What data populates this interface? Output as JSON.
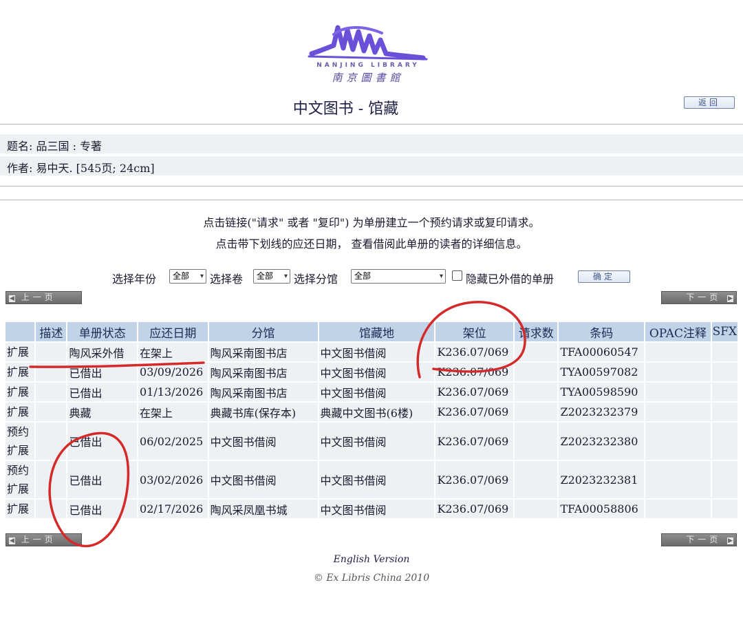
{
  "logo": {
    "english_text": "NANJING   LIBRARY",
    "chinese_text": "南京圖書館"
  },
  "header": {
    "title": "中文图书 - 馆藏",
    "back_label": "返回"
  },
  "record": {
    "title_line": "题名: 品三国 : 专著",
    "author_line": "作者: 易中天. [545页; 24cm]"
  },
  "instructions": {
    "line1": "点击链接(\"请求\" 或者 \"复印\") 为单册建立一个预约请求或复印请求。",
    "line2": "点击带下划线的应还日期， 查看借阅此单册的读者的详细信息。"
  },
  "filters": {
    "year_label": "选择年份",
    "year_value": "全部",
    "volume_label": "选择卷",
    "volume_value": "全部",
    "branch_label": "选择分馆",
    "branch_value": "全部",
    "hide_label": "隐藏已外借的单册",
    "confirm_label": "确定"
  },
  "pagination": {
    "prev_label": "上一页",
    "next_label": "下一页"
  },
  "table": {
    "headers": [
      "",
      "描述",
      "单册状态",
      "应还日期",
      "分馆",
      "馆藏地",
      "架位",
      "请求数",
      "条码",
      "OPAC注释",
      "SFX"
    ],
    "rows": [
      {
        "type": "扩展",
        "desc": "",
        "status": "陶风采外借",
        "due": "在架上",
        "branch": "陶风采南图书店",
        "location": "中文图书借阅",
        "shelf": "K236.07/069",
        "requests": "",
        "barcode": "TFA00060547",
        "note": "",
        "sfx": ""
      },
      {
        "type": "扩展",
        "desc": "",
        "status": "已借出",
        "due": "03/09/2026",
        "branch": "陶风采南图书店",
        "location": "中文图书借阅",
        "shelf": "K236.07/069",
        "requests": "",
        "barcode": "TYA00597082",
        "note": "",
        "sfx": ""
      },
      {
        "type": "扩展",
        "desc": "",
        "status": "已借出",
        "due": "01/13/2026",
        "branch": "陶风采南图书店",
        "location": "中文图书借阅",
        "shelf": "K236.07/069",
        "requests": "",
        "barcode": "TYA00598590",
        "note": "",
        "sfx": ""
      },
      {
        "type": "扩展",
        "desc": "",
        "status": "典藏",
        "due": "在架上",
        "branch": "典藏书库(保存本)",
        "location": "典藏中文图书(6楼)",
        "shelf": "K236.07/069",
        "requests": "",
        "barcode": "Z2023232379",
        "note": "",
        "sfx": ""
      },
      {
        "type": "预约 扩展",
        "desc": "",
        "status": "已借出",
        "due": "06/02/2025",
        "branch": "中文图书借阅",
        "location": "中文图书借阅",
        "shelf": "K236.07/069",
        "requests": "",
        "barcode": "Z2023232380",
        "note": "",
        "sfx": ""
      },
      {
        "type": "预约 扩展",
        "desc": "",
        "status": "已借出",
        "due": "03/02/2026",
        "branch": "中文图书借阅",
        "location": "中文图书借阅",
        "shelf": "K236.07/069",
        "requests": "",
        "barcode": "Z2023232381",
        "note": "",
        "sfx": ""
      },
      {
        "type": "扩展",
        "desc": "",
        "status": "已借出",
        "due": "02/17/2026",
        "branch": "陶风采凤凰书城",
        "location": "中文图书借阅",
        "shelf": "K236.07/069",
        "requests": "",
        "barcode": "TFA00058806",
        "note": "",
        "sfx": ""
      }
    ]
  },
  "footer": {
    "english_link": "English Version",
    "copyright": "© Ex Libris China 2010"
  },
  "colors": {
    "header_cell": "#c2d3e8",
    "body_cell": "#eef1f4",
    "pager_button": "#7a7a7a",
    "annotation_ink": "#d42a2a",
    "logo_purple": "#6a4fd8"
  }
}
